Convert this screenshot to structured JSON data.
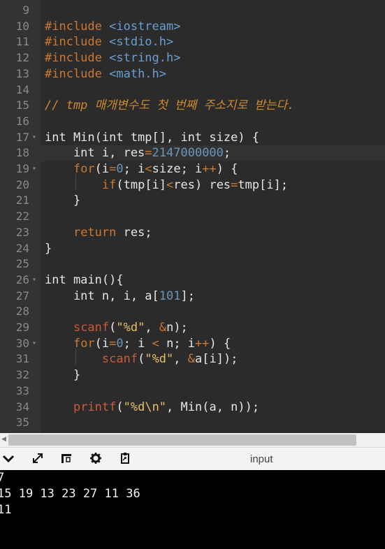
{
  "editor": {
    "lines": [
      {
        "n": "9",
        "tokens": []
      },
      {
        "n": "10",
        "tokens": [
          {
            "t": "#include ",
            "c": "t-pp"
          },
          {
            "t": "<iostream>",
            "c": "t-inc"
          }
        ]
      },
      {
        "n": "11",
        "tokens": [
          {
            "t": "#include ",
            "c": "t-pp"
          },
          {
            "t": "<stdio.h>",
            "c": "t-inc"
          }
        ]
      },
      {
        "n": "12",
        "tokens": [
          {
            "t": "#include ",
            "c": "t-pp"
          },
          {
            "t": "<string.h>",
            "c": "t-inc"
          }
        ]
      },
      {
        "n": "13",
        "tokens": [
          {
            "t": "#include ",
            "c": "t-pp"
          },
          {
            "t": "<math.h>",
            "c": "t-inc"
          }
        ]
      },
      {
        "n": "14",
        "tokens": []
      },
      {
        "n": "15",
        "tokens": [
          {
            "t": "// tmp 매개변수도 첫 번째 주소지로 받는다.",
            "c": "t-cmt"
          }
        ]
      },
      {
        "n": "16",
        "tokens": []
      },
      {
        "n": "17",
        "fold": true,
        "tokens": [
          {
            "t": "int Min(int tmp[], int size) {",
            "c": "t-plain"
          }
        ]
      },
      {
        "n": "18",
        "active": true,
        "tokens": [
          {
            "t": "    int i, res",
            "c": "t-plain"
          },
          {
            "t": "=",
            "c": "t-op"
          },
          {
            "t": "2147000000",
            "c": "t-num"
          },
          {
            "t": ";",
            "c": "t-plain"
          }
        ]
      },
      {
        "n": "19",
        "fold": true,
        "tokens": [
          {
            "t": "    ",
            "c": "t-plain"
          },
          {
            "t": "for",
            "c": "t-kw"
          },
          {
            "t": "(i",
            "c": "t-plain"
          },
          {
            "t": "=",
            "c": "t-op"
          },
          {
            "t": "0",
            "c": "t-num"
          },
          {
            "t": "; i",
            "c": "t-plain"
          },
          {
            "t": "<",
            "c": "t-op"
          },
          {
            "t": "size; i",
            "c": "t-plain"
          },
          {
            "t": "++",
            "c": "t-op"
          },
          {
            "t": ") {",
            "c": "t-plain"
          }
        ]
      },
      {
        "n": "20",
        "tokens": [
          {
            "t": "        ",
            "c": "t-plain"
          },
          {
            "t": "if",
            "c": "t-kw"
          },
          {
            "t": "(tmp[i]",
            "c": "t-plain"
          },
          {
            "t": "<",
            "c": "t-op"
          },
          {
            "t": "res) res",
            "c": "t-plain"
          },
          {
            "t": "=",
            "c": "t-op"
          },
          {
            "t": "tmp[i];",
            "c": "t-plain"
          }
        ]
      },
      {
        "n": "21",
        "tokens": [
          {
            "t": "    }",
            "c": "t-plain"
          }
        ]
      },
      {
        "n": "22",
        "tokens": []
      },
      {
        "n": "23",
        "tokens": [
          {
            "t": "    ",
            "c": "t-plain"
          },
          {
            "t": "return",
            "c": "t-kw"
          },
          {
            "t": " res;",
            "c": "t-plain"
          }
        ]
      },
      {
        "n": "24",
        "tokens": [
          {
            "t": "}",
            "c": "t-plain"
          }
        ]
      },
      {
        "n": "25",
        "tokens": []
      },
      {
        "n": "26",
        "fold": true,
        "tokens": [
          {
            "t": "int main(){",
            "c": "t-plain"
          }
        ]
      },
      {
        "n": "27",
        "tokens": [
          {
            "t": "    int n, i, a[",
            "c": "t-plain"
          },
          {
            "t": "101",
            "c": "t-num"
          },
          {
            "t": "];",
            "c": "t-plain"
          }
        ]
      },
      {
        "n": "28",
        "tokens": []
      },
      {
        "n": "29",
        "tokens": [
          {
            "t": "    ",
            "c": "t-plain"
          },
          {
            "t": "scanf",
            "c": "t-lib"
          },
          {
            "t": "(",
            "c": "t-plain"
          },
          {
            "t": "\"%d\"",
            "c": "t-str"
          },
          {
            "t": ", ",
            "c": "t-plain"
          },
          {
            "t": "&",
            "c": "t-op"
          },
          {
            "t": "n);",
            "c": "t-plain"
          }
        ]
      },
      {
        "n": "30",
        "fold": true,
        "tokens": [
          {
            "t": "    ",
            "c": "t-plain"
          },
          {
            "t": "for",
            "c": "t-kw"
          },
          {
            "t": "(i",
            "c": "t-plain"
          },
          {
            "t": "=",
            "c": "t-op"
          },
          {
            "t": "0",
            "c": "t-num"
          },
          {
            "t": "; i ",
            "c": "t-plain"
          },
          {
            "t": "<",
            "c": "t-op"
          },
          {
            "t": " n; i",
            "c": "t-plain"
          },
          {
            "t": "++",
            "c": "t-op"
          },
          {
            "t": ") {",
            "c": "t-plain"
          }
        ]
      },
      {
        "n": "31",
        "tokens": [
          {
            "t": "        ",
            "c": "t-plain"
          },
          {
            "t": "scanf",
            "c": "t-lib"
          },
          {
            "t": "(",
            "c": "t-plain"
          },
          {
            "t": "\"%d\"",
            "c": "t-str"
          },
          {
            "t": ", ",
            "c": "t-plain"
          },
          {
            "t": "&",
            "c": "t-op"
          },
          {
            "t": "a[i]);",
            "c": "t-plain"
          }
        ]
      },
      {
        "n": "32",
        "tokens": [
          {
            "t": "    }",
            "c": "t-plain"
          }
        ]
      },
      {
        "n": "33",
        "tokens": []
      },
      {
        "n": "34",
        "tokens": [
          {
            "t": "    ",
            "c": "t-plain"
          },
          {
            "t": "printf",
            "c": "t-lib"
          },
          {
            "t": "(",
            "c": "t-plain"
          },
          {
            "t": "\"%d\\n\"",
            "c": "t-str"
          },
          {
            "t": ", Min(a, n));",
            "c": "t-plain"
          }
        ]
      },
      {
        "n": "35",
        "tokens": []
      }
    ]
  },
  "toolbar": {
    "input_label": "input",
    "icons": [
      "chevron-down-icon",
      "expand-icon",
      "layout-icon",
      "gear-icon",
      "clipboard-icon"
    ]
  },
  "console": {
    "lines": [
      "7",
      "15 19 13 23 27 11 36",
      "11"
    ]
  }
}
